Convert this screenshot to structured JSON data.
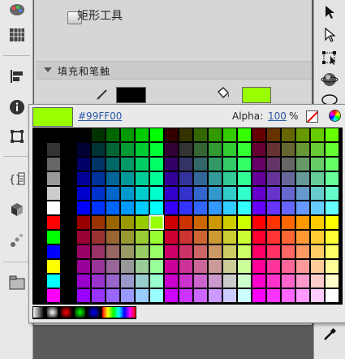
{
  "tool": {
    "title": "矩形工具"
  },
  "fill_stroke": {
    "section_label": "填充和笔触",
    "stroke_color": "#000000",
    "fill_color": "#99ff00"
  },
  "picker": {
    "current_color": "#99ff00",
    "hex_value": "#99FF00",
    "alpha_label": "Alpha:",
    "alpha_value": "100",
    "alpha_unit": "%",
    "no_color_icon": "no-color-icon",
    "color_wheel_icon": "color-wheel-icon",
    "selected_swatch_color": "#99ff00",
    "grayscale_column": [
      "#000000",
      "#333333",
      "#666666",
      "#999999",
      "#cccccc",
      "#ffffff",
      "#ff0000",
      "#00ff00",
      "#0000ff",
      "#ffff00",
      "#00ffff",
      "#ff00ff"
    ],
    "gradient_swatches": [
      "linear-gray",
      "radial-bw",
      "radial-red",
      "radial-green",
      "radial-blue",
      "linear-rainbow"
    ]
  },
  "icons": {
    "left_dock": [
      "palette-icon",
      "swatches-icon",
      "align-icon",
      "info-icon",
      "transform-icon",
      "code-snippets-icon",
      "components-icon",
      "motion-presets-icon",
      "library-icon"
    ],
    "right_tools": [
      "selection-tool-icon",
      "subselection-tool-icon",
      "free-transform-tool-icon",
      "3d-rotation-tool-icon",
      "lasso-tool-icon",
      "eyedropper-tool-icon"
    ]
  }
}
